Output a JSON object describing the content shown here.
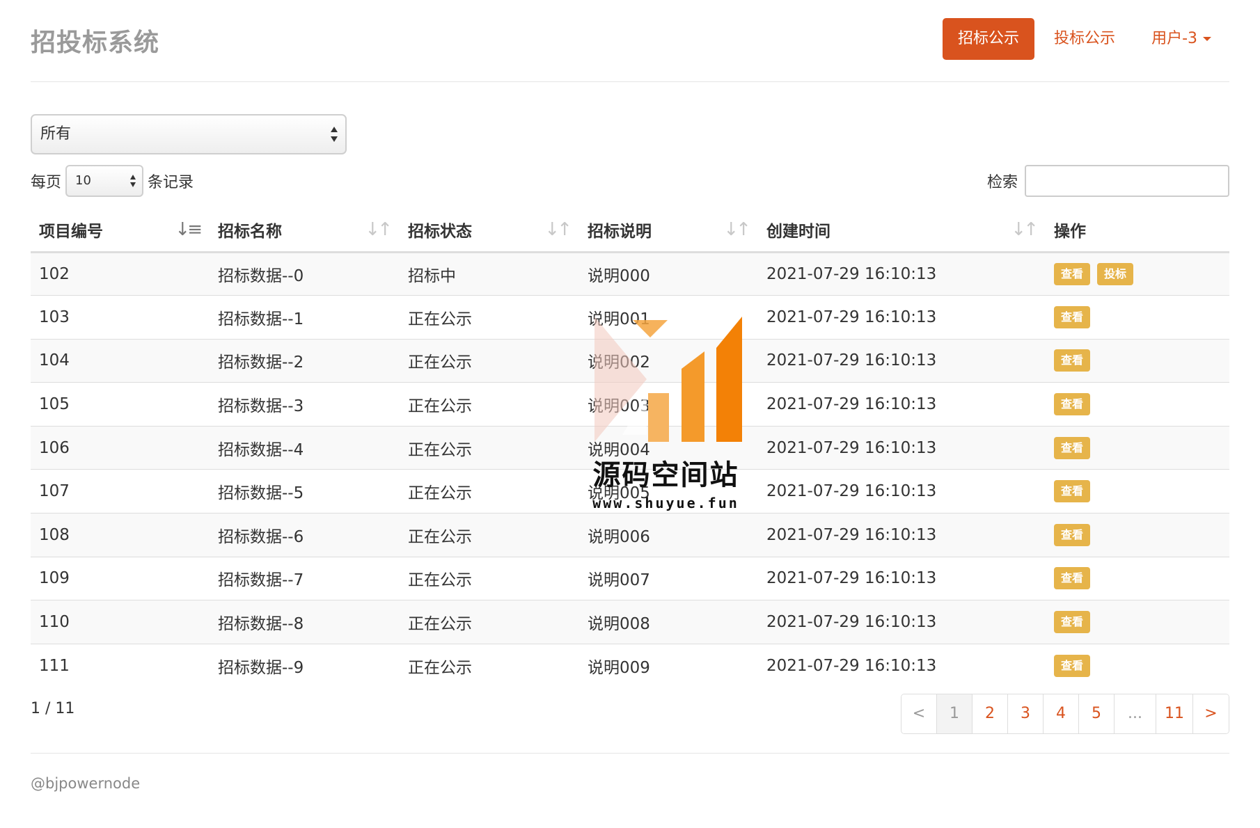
{
  "header": {
    "brand": "招投标系统",
    "nav": [
      {
        "label": "招标公示",
        "active": true
      },
      {
        "label": "投标公示",
        "active": false
      },
      {
        "label": "用户-3",
        "dropdown": true
      }
    ]
  },
  "filter": {
    "selected": "所有"
  },
  "length_menu": {
    "prefix": "每页",
    "value": "10",
    "suffix": "条记录"
  },
  "search": {
    "label": "检索",
    "value": ""
  },
  "table": {
    "columns": [
      "项目编号",
      "招标名称",
      "招标状态",
      "招标说明",
      "创建时间",
      "操作"
    ],
    "rows": [
      {
        "id": "102",
        "name": "招标数据--0",
        "status": "招标中",
        "desc": "说明000",
        "time": "2021-07-29 16:10:13",
        "actions": [
          "查看",
          "投标"
        ]
      },
      {
        "id": "103",
        "name": "招标数据--1",
        "status": "正在公示",
        "desc": "说明001",
        "time": "2021-07-29 16:10:13",
        "actions": [
          "查看"
        ]
      },
      {
        "id": "104",
        "name": "招标数据--2",
        "status": "正在公示",
        "desc": "说明002",
        "time": "2021-07-29 16:10:13",
        "actions": [
          "查看"
        ]
      },
      {
        "id": "105",
        "name": "招标数据--3",
        "status": "正在公示",
        "desc": "说明003",
        "time": "2021-07-29 16:10:13",
        "actions": [
          "查看"
        ]
      },
      {
        "id": "106",
        "name": "招标数据--4",
        "status": "正在公示",
        "desc": "说明004",
        "time": "2021-07-29 16:10:13",
        "actions": [
          "查看"
        ]
      },
      {
        "id": "107",
        "name": "招标数据--5",
        "status": "正在公示",
        "desc": "说明005",
        "time": "2021-07-29 16:10:13",
        "actions": [
          "查看"
        ]
      },
      {
        "id": "108",
        "name": "招标数据--6",
        "status": "正在公示",
        "desc": "说明006",
        "time": "2021-07-29 16:10:13",
        "actions": [
          "查看"
        ]
      },
      {
        "id": "109",
        "name": "招标数据--7",
        "status": "正在公示",
        "desc": "说明007",
        "time": "2021-07-29 16:10:13",
        "actions": [
          "查看"
        ]
      },
      {
        "id": "110",
        "name": "招标数据--8",
        "status": "正在公示",
        "desc": "说明008",
        "time": "2021-07-29 16:10:13",
        "actions": [
          "查看"
        ]
      },
      {
        "id": "111",
        "name": "招标数据--9",
        "status": "正在公示",
        "desc": "说明009",
        "time": "2021-07-29 16:10:13",
        "actions": [
          "查看"
        ]
      }
    ]
  },
  "pagination": {
    "info": "1 / 11",
    "pages": [
      "<",
      "1",
      "2",
      "3",
      "4",
      "5",
      "...",
      "11",
      ">"
    ],
    "current": "1"
  },
  "footer": {
    "text": "@bjpowernode"
  },
  "watermark": {
    "text": "源码空间站",
    "url": "www.shuyue.fun"
  },
  "colors": {
    "accent": "#d9531e",
    "action_button": "#e6b44a"
  }
}
